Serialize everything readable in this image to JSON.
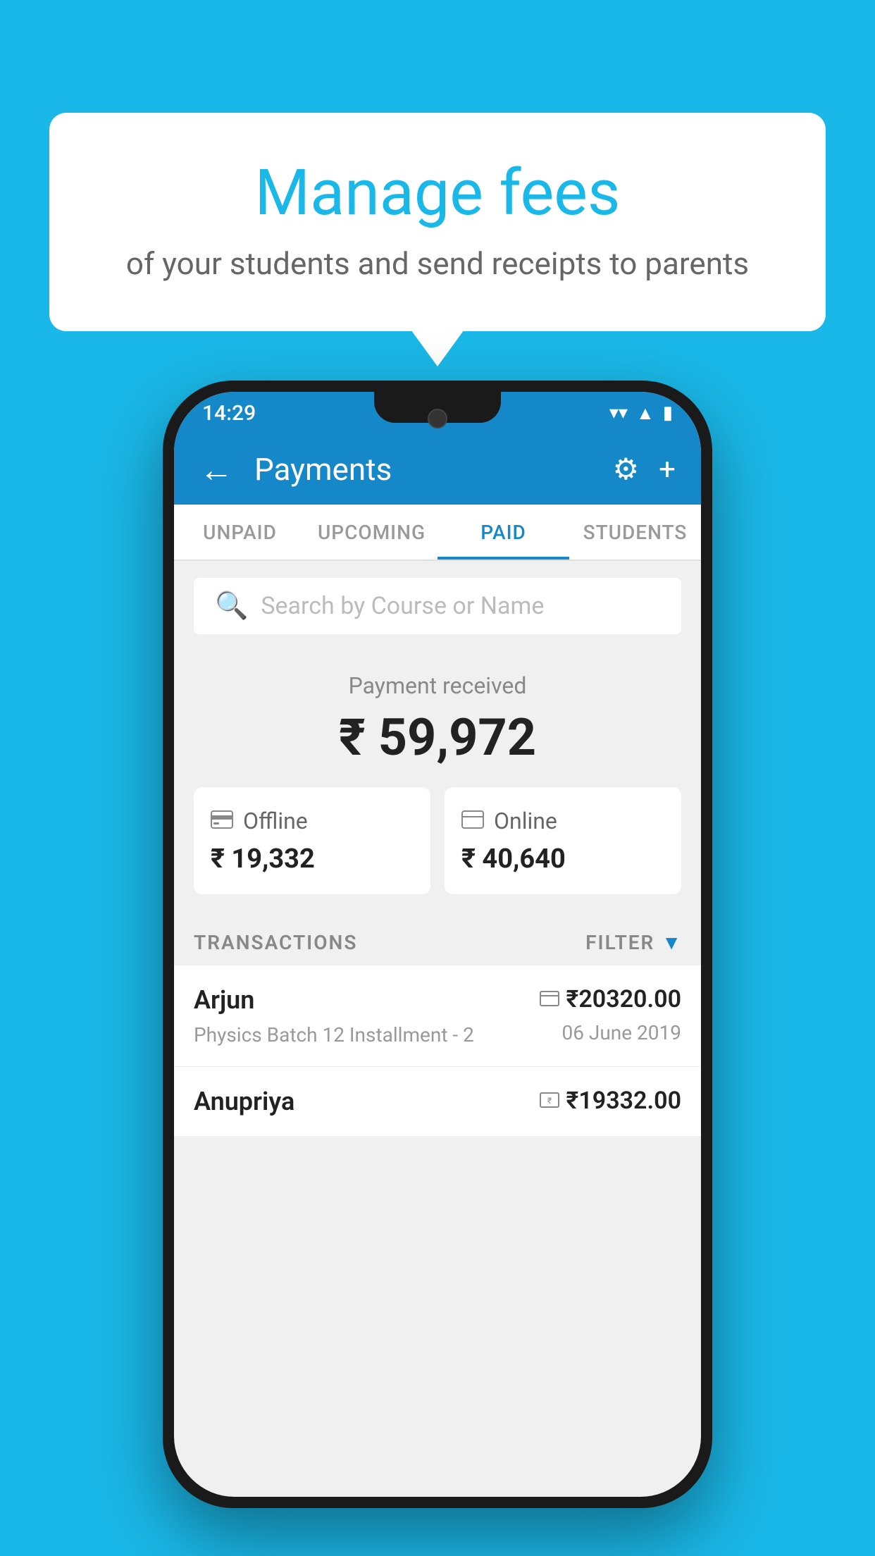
{
  "background_color": "#1ab8e8",
  "speech_bubble": {
    "title": "Manage fees",
    "subtitle": "of your students and send receipts to parents"
  },
  "status_bar": {
    "time": "14:29",
    "wifi_icon": "wifi",
    "signal_icon": "signal",
    "battery_icon": "battery"
  },
  "app_bar": {
    "back_icon": "←",
    "title": "Payments",
    "settings_icon": "⚙",
    "add_icon": "+"
  },
  "tabs": [
    {
      "label": "UNPAID",
      "active": false
    },
    {
      "label": "UPCOMING",
      "active": false
    },
    {
      "label": "PAID",
      "active": true
    },
    {
      "label": "STUDENTS",
      "active": false
    }
  ],
  "search": {
    "placeholder": "Search by Course or Name",
    "icon": "🔍"
  },
  "payment_summary": {
    "received_label": "Payment received",
    "total_amount": "₹ 59,972",
    "offline": {
      "type": "Offline",
      "amount": "₹ 19,332"
    },
    "online": {
      "type": "Online",
      "amount": "₹ 40,640"
    }
  },
  "transactions_section": {
    "label": "TRANSACTIONS",
    "filter_label": "FILTER",
    "items": [
      {
        "name": "Arjun",
        "description": "Physics Batch 12 Installment - 2",
        "amount": "₹20320.00",
        "date": "06 June 2019",
        "payment_type": "card"
      },
      {
        "name": "Anupriya",
        "description": "",
        "amount": "₹19332.00",
        "date": "",
        "payment_type": "cash"
      }
    ]
  }
}
